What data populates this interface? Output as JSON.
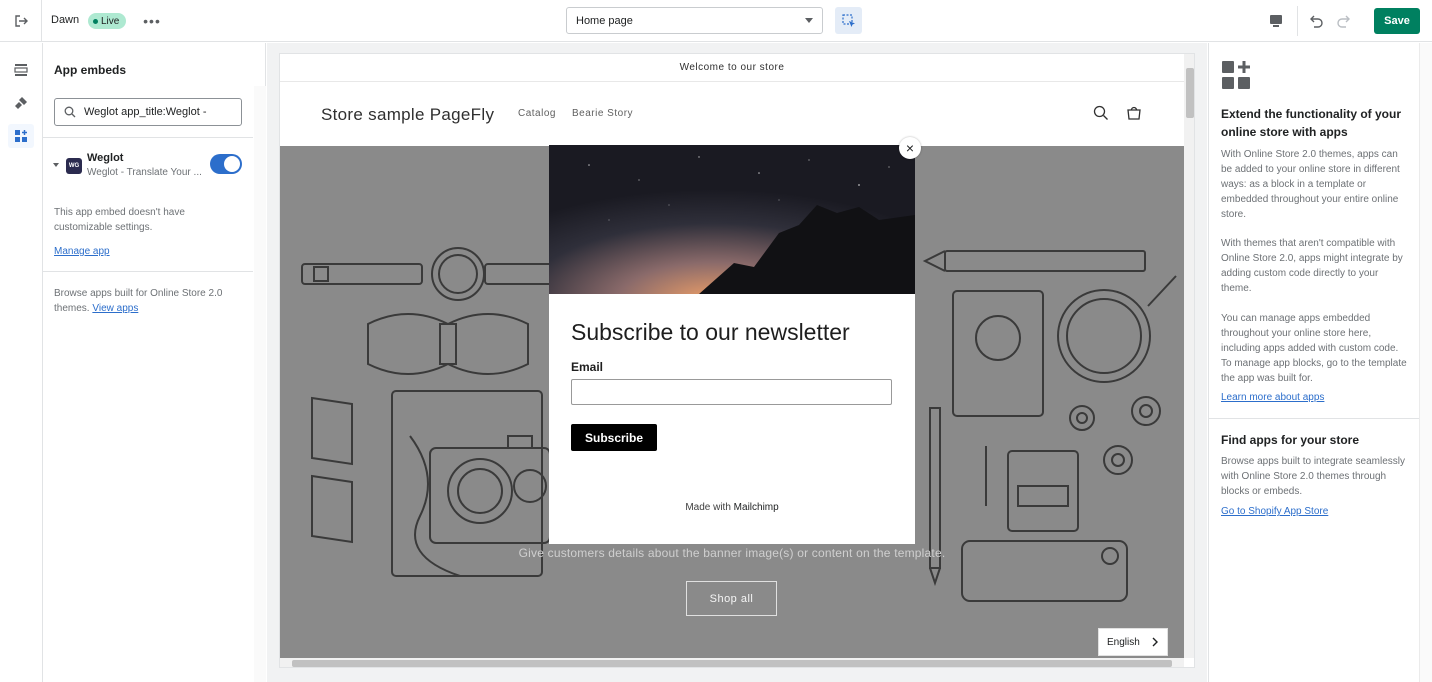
{
  "topbar": {
    "theme_name": "Dawn",
    "status": "Live",
    "page_select_value": "Home page",
    "save_label": "Save"
  },
  "sidebar": {
    "title": "App embeds",
    "search_value": "Weglot app_title:Weglot -",
    "app": {
      "name": "Weglot",
      "logo_text": "WG",
      "description": "Weglot - Translate Your ...",
      "enabled": true
    },
    "note": "This app embed doesn't have customizable settings.",
    "manage_link": "Manage app",
    "browse_text": "Browse apps built for Online Store 2.0 themes.",
    "view_apps_link": "View apps"
  },
  "preview": {
    "announcement": "Welcome to our store",
    "store_name": "Store sample PageFly",
    "nav": [
      "Catalog",
      "Bearie Story"
    ],
    "banner_text": "Give customers details about the banner image(s) or content on the template.",
    "shop_button": "Shop all",
    "language": "English",
    "popup": {
      "title": "Subscribe to our newsletter",
      "email_label": "Email",
      "email_value": "",
      "subscribe_button": "Subscribe",
      "footer_prefix": "Made with",
      "footer_brand": "Mailchimp",
      "close_label": "×"
    }
  },
  "rightpanel": {
    "heading": "Extend the functionality of your online store with apps",
    "p1": "With Online Store 2.0 themes, apps can be added to your online store in different ways: as a block in a template or embedded throughout your entire online store.",
    "p2": "With themes that aren't compatible with Online Store 2.0, apps might integrate by adding custom code directly to your theme.",
    "p3": "You can manage apps embedded throughout your online store here, including apps added with custom code. To manage app blocks, go to the template the app was built for.",
    "learn_link": "Learn more about apps",
    "find_heading": "Find apps for your store",
    "find_text": "Browse apps built to integrate seamlessly with Online Store 2.0 themes through blocks or embeds.",
    "store_link": "Go to Shopify App Store"
  },
  "colors": {
    "save_green": "#008060",
    "link_blue": "#2c6ecb",
    "live_badge": "#aee9d1",
    "toggle_on": "#2c6ecb"
  },
  "icons": [
    "exit-icon",
    "more-icon",
    "chevron-down-icon",
    "inspector-icon",
    "desktop-icon",
    "undo-icon",
    "redo-icon",
    "sections-icon",
    "theme-settings-icon",
    "app-embeds-icon",
    "search-icon",
    "cart-icon",
    "close-icon",
    "chevron-right-icon",
    "apps-add-icon"
  ]
}
